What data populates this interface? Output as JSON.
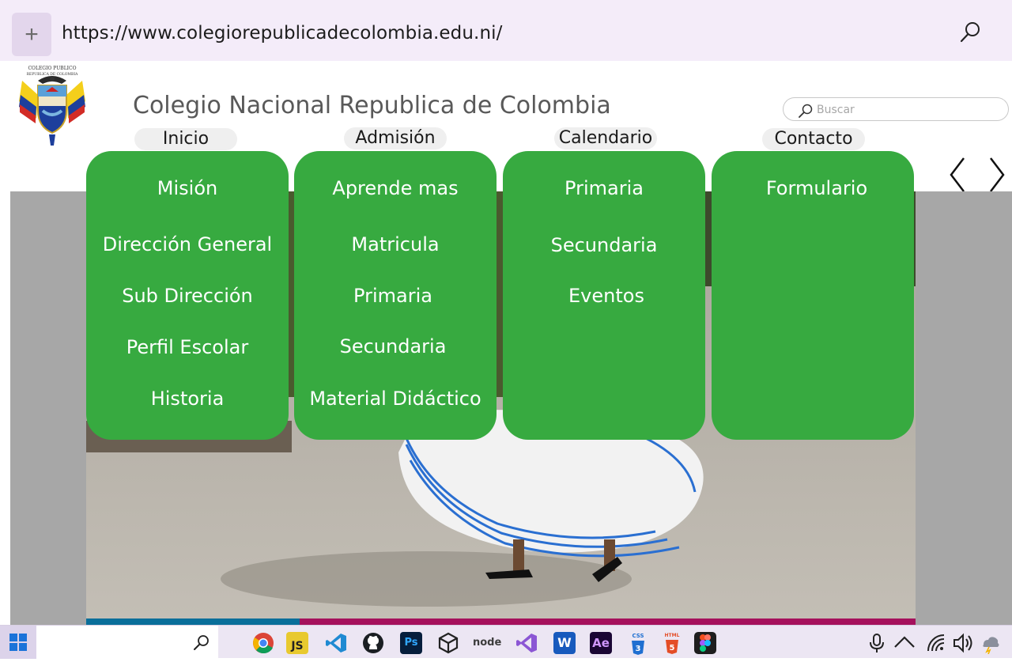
{
  "browser": {
    "new_tab_label": "+",
    "url": "https://www.colegiorepublicadecolombia.edu.ni/"
  },
  "site": {
    "title": "Colegio Nacional Republica de Colombia",
    "logo_text_line1": "COLEGIO PUBLICO",
    "logo_text_line2": "REPUBLICA DE COLOMBIA",
    "search_placeholder": "Buscar"
  },
  "nav": {
    "tabs": [
      {
        "label": "Inicio"
      },
      {
        "label": "Admisión"
      },
      {
        "label": "Calendario"
      },
      {
        "label": "Contacto"
      }
    ]
  },
  "menus": {
    "inicio": [
      "Misión",
      "Dirección General",
      "Sub Dirección",
      "Perfil Escolar",
      "Historia"
    ],
    "admision": [
      "Aprende mas",
      "Matricula",
      "Primaria",
      "Secundaria",
      "Material Didáctico"
    ],
    "calendario": [
      "Primaria",
      "Secundaria",
      "Eventos"
    ],
    "contacto": [
      "Formulario"
    ]
  },
  "colors": {
    "menu_green": "#37aa40",
    "browser_bar": "#f4ecf9",
    "strip_blue": "#0a6f9a",
    "strip_magenta": "#a5115c"
  },
  "taskbar": {
    "apps": [
      "chrome-icon",
      "javascript-icon",
      "vscode-icon",
      "github-icon",
      "photoshop-icon",
      "unity-icon",
      "nodejs-icon",
      "visual-studio-icon",
      "word-icon",
      "after-effects-icon",
      "css3-icon",
      "html5-icon",
      "figma-icon"
    ],
    "labels": {
      "js": "JS",
      "ps": "Ps",
      "word": "W",
      "ae": "Ae",
      "css": "CSS",
      "html": "HTML",
      "node": "node"
    }
  }
}
